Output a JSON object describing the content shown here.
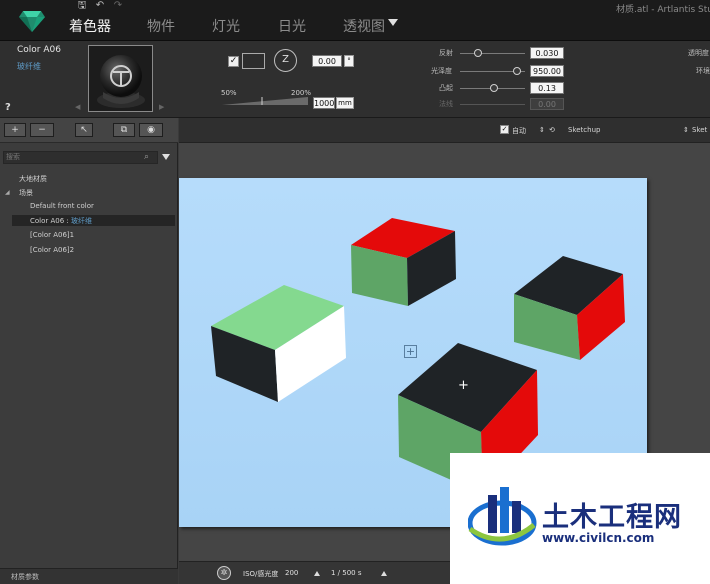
{
  "window": {
    "title": "材质.atl - Artlantis Studio"
  },
  "quick_tools": {
    "save": "🖫",
    "undo": "↶",
    "redo": "↷"
  },
  "tabs": [
    {
      "label": "着色器",
      "active": true
    },
    {
      "label": "物件",
      "active": false
    },
    {
      "label": "灯光",
      "active": false
    },
    {
      "label": "日光",
      "active": false
    },
    {
      "label": "透视图",
      "active": false
    }
  ],
  "material": {
    "name": "Color A06",
    "subtitle": "玻纤维",
    "help": "?",
    "swatch_color": "#2d2d2d",
    "timer_label": "Z",
    "angle_value": "0.00",
    "angle_unit": "°",
    "scale_min": "50%",
    "scale_max": "200%",
    "scale_value": "1000",
    "scale_unit": "mm",
    "params": [
      {
        "label": "反射",
        "value": "0.030",
        "enabled": true
      },
      {
        "label": "光泽度",
        "value": "950.00",
        "enabled": true
      },
      {
        "label": "凸起",
        "value": "0.13",
        "enabled": true
      },
      {
        "label": "法线",
        "value": "0.00",
        "enabled": false
      }
    ],
    "right_labels": {
      "transparency": "透明度",
      "env": "环境"
    }
  },
  "left_panel": {
    "toolbar": {
      "add": "+",
      "remove": "−",
      "select": "↖",
      "copy": "⧉",
      "view": "◉"
    },
    "search_placeholder": "搜索",
    "tree": [
      {
        "label": "大地材质",
        "indent": 0,
        "selected": false
      },
      {
        "label": "场景",
        "indent": 0,
        "selected": false
      },
      {
        "label": "Default front color",
        "indent": 1,
        "selected": false
      },
      {
        "label": "Color A06 :",
        "sub": "玻纤维",
        "indent": 1,
        "selected": true
      },
      {
        "label": "[Color A06]1",
        "indent": 1,
        "selected": false
      },
      {
        "label": "[Color A06]2",
        "indent": 1,
        "selected": false
      }
    ],
    "footer": "材质参数"
  },
  "viewport": {
    "auto_label": "自动",
    "plugin_label": "Sketchup",
    "plugin_label_2": "Sket",
    "iso_label": "ISO/感光度",
    "iso_value": "200",
    "shutter_value": "1 / 500 s",
    "scene_colors": {
      "green": "#5ea566",
      "light_green": "#84d98f",
      "red": "#e40a0a",
      "black": "#1f2326",
      "white": "#ffffff"
    }
  },
  "watermark": {
    "title": "土木工程网",
    "url": "www.civilcn.com"
  }
}
